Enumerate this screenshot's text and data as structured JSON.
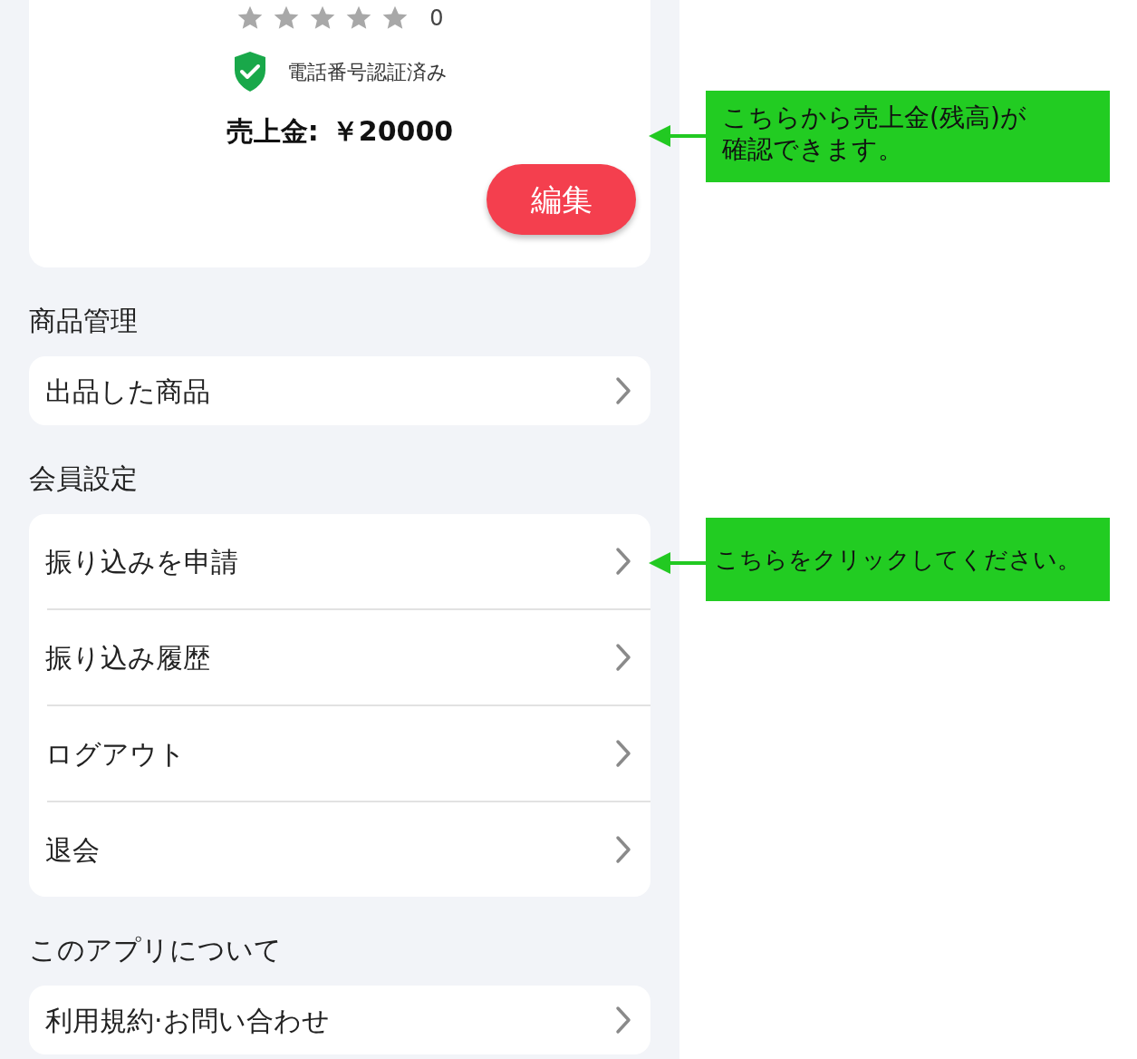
{
  "profile": {
    "rating_count": "0",
    "verification": "電話番号認証済み",
    "balance_label": "売上金:",
    "balance_value": "￥20000",
    "edit_button": "編集"
  },
  "sections": [
    {
      "title": "商品管理",
      "items": [
        {
          "label": "出品した商品"
        }
      ]
    },
    {
      "title": "会員設定",
      "items": [
        {
          "label": "振り込みを申請"
        },
        {
          "label": "振り込み履歴"
        },
        {
          "label": "ログアウト"
        },
        {
          "label": "退会"
        }
      ]
    },
    {
      "title": "このアプリについて",
      "items": [
        {
          "label": "利用規約·お問い合わせ"
        }
      ]
    }
  ],
  "annotations": [
    {
      "lines": [
        "こちらから売上金(残高)が",
        "確認できます。"
      ]
    },
    {
      "lines": [
        "こちらをクリックしてください。"
      ]
    }
  ]
}
